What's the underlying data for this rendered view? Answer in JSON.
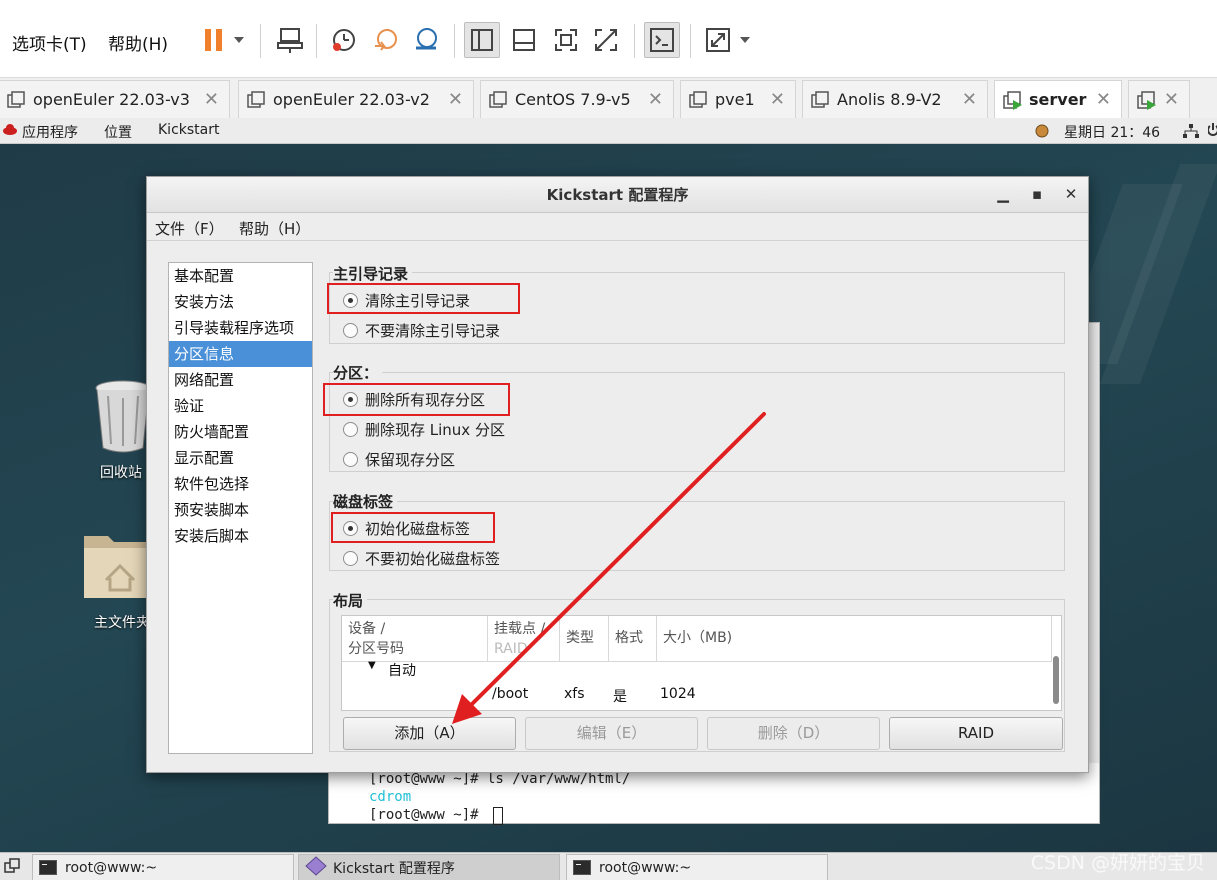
{
  "vm_toolbar": {
    "menu_tabs": "选项卡(T)",
    "menu_help": "帮助(H)"
  },
  "vm_tabs": [
    {
      "label": "openEuler 22.03-v3"
    },
    {
      "label": "openEuler 22.03-v2"
    },
    {
      "label": "CentOS 7.9-v5"
    },
    {
      "label": "pve1"
    },
    {
      "label": "Anolis 8.9-V2"
    },
    {
      "label": "server"
    }
  ],
  "gnome_bar": {
    "applications": "应用程序",
    "places": "位置",
    "app_name": "Kickstart",
    "clock": "星期日 21：46"
  },
  "desktop": {
    "trash_label": "回收站",
    "home_label": "主文件夹"
  },
  "terminal": {
    "line1": "[root@www ~]# ls /var/www/html/",
    "line2": "cdrom",
    "line3": "[root@www ~]# "
  },
  "dialog": {
    "title": "Kickstart 配置程序",
    "menu_file": "文件（F）",
    "menu_help": "帮助（H）",
    "nav": [
      "基本配置",
      "安装方法",
      "引导装载程序选项",
      "分区信息",
      "网络配置",
      "验证",
      "防火墙配置",
      "显示配置",
      "软件包选择",
      "预安装脚本",
      "安装后脚本"
    ],
    "selected_nav_index": 3,
    "mbr": {
      "label": "主引导记录",
      "option_clear": "清除主引导记录",
      "option_keep": "不要清除主引导记录",
      "selected": "clear"
    },
    "partition": {
      "label": "分区：",
      "option_remove_all": "删除所有现存分区",
      "option_remove_linux": "删除现存 Linux 分区",
      "option_preserve": "保留现存分区",
      "selected": "remove_all"
    },
    "disklabel": {
      "label": "磁盘标签",
      "option_init": "初始化磁盘标签",
      "option_no_init": "不要初始化磁盘标签",
      "selected": "init"
    },
    "layout": {
      "label": "布局",
      "columns": {
        "device_line1": "设备 /",
        "device_line2": "分区号码",
        "mount_line1": "挂载点 /",
        "mount_line2": "RAID",
        "type": "类型",
        "format": "格式",
        "size": "大小（MB)"
      },
      "group_row": "自动",
      "rows": [
        {
          "mount": "/boot",
          "type": "xfs",
          "format": "是",
          "size": "1024"
        }
      ]
    },
    "buttons": {
      "add": "添加（A）",
      "edit": "编辑（E）",
      "delete": "删除（D）",
      "raid": "RAID"
    }
  },
  "taskbar": {
    "items": [
      {
        "label": "root@www:~"
      },
      {
        "label": "Kickstart 配置程序"
      },
      {
        "label": "root@www:~"
      }
    ]
  },
  "watermark": "CSDN @妍妍的宝贝",
  "colors": {
    "annotation_red": "#e02020",
    "selection_blue": "#4a90d9",
    "desktop_teal": "#234753"
  }
}
